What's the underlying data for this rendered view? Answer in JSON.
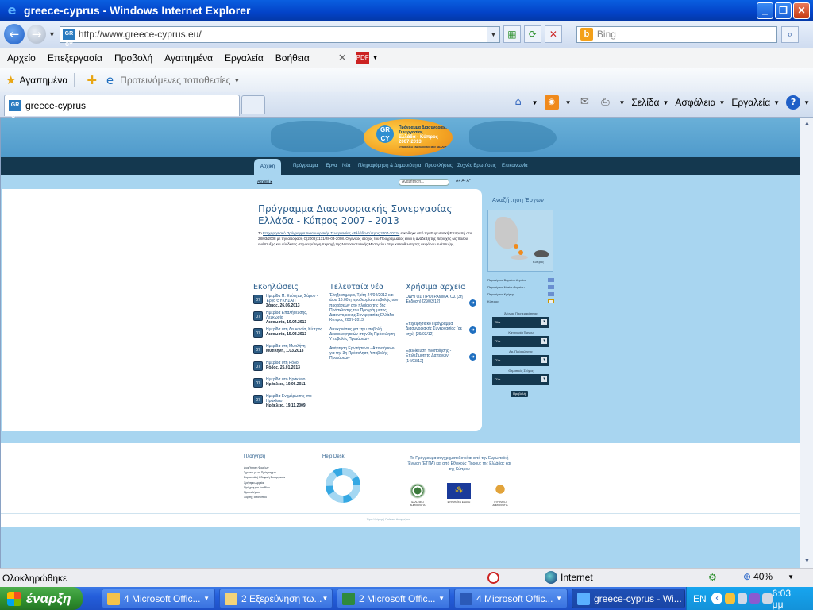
{
  "window": {
    "title": "greece-cyprus - Windows Internet Explorer"
  },
  "address": {
    "url": "http://www.greece-cyprus.eu/",
    "search_placeholder": "Bing",
    "favicon": "GR CY"
  },
  "menu": [
    "Αρχείο",
    "Επεξεργασία",
    "Προβολή",
    "Αγαπημένα",
    "Εργαλεία",
    "Βοήθεια"
  ],
  "favorites": {
    "label": "Αγαπημένα",
    "suggested": "Προτεινόμενες τοποθεσίες"
  },
  "tab": {
    "title": "greece-cyprus"
  },
  "commands": {
    "page": "Σελίδα",
    "safety": "Ασφάλεια",
    "tools": "Εργαλεία"
  },
  "site": {
    "logo": {
      "mark": "GR CY",
      "line1": "Πρόγραμμα Διασυνοριακής Συνεργασίας",
      "line2": "Ελλάδα - Κύπρος 2007-2013",
      "line3": "ΕΥΡΩΠΑΪΚΗ ΕΝΩΣΗ ΚΟΙΝΟ ΜΑΣ ΜΕΛΛΟΝ"
    },
    "nav": [
      "Αρχική",
      "Πρόγραμμα",
      "Έργα",
      "Νέα",
      "Πληροφόρηση & Δημοσιότητα",
      "Προσκλήσεις",
      "Συχνές Ερωτήσεις",
      "Επικοινωνία"
    ],
    "breadcrumb": "Αρχική ▸",
    "search_placeholder": "Αναζήτηση...",
    "font_sizes": "A+ A- A*",
    "title": "Πρόγραμμα Διασυνοριακής Συνεργασίας Ελλάδα - Κύπρος 2007 - 2013",
    "intro_link": "Επιχειρησιακό Πρόγραμμα Διασυνοριακής Συνεργασίας «Ελλάδα-Κύπρος 2007-2013»",
    "intro_pre": "Το",
    "intro_rest": "εγκρίθηκε από την Ευρωπαϊκή Επιτροπή στις 28/03/2008 με την απόφαση C(2008)1131/28-03-2008. Ο γενικός στόχος του Προγράμματος είναι η ανάδειξη της περιοχής ως πόλου ανάπτυξης και σύνδεσης στην ευρύτερη περιοχή της Νοτιοανατολικής Μεσογείου στην κατεύθυνση της αειφόρου ανάπτυξης.",
    "events_title": "Εκδηλώσεις",
    "events": [
      {
        "day": "07",
        "text": "Ημερίδα Π. Ενότητας Σάμου - Έργο ΘΥΚΗΣΑΠ",
        "date": "Σάμος, 26.06.2013"
      },
      {
        "day": "07",
        "text": "Ημερίδα Επαλήθευσης, Λευκωσία",
        "date": "Λευκωσία, 19.04.2013"
      },
      {
        "day": "07",
        "text": "Ημερίδα στη Λευκωσία, Κύπρος",
        "date": "Λευκωσία, 15.03.2013"
      },
      {
        "day": "07",
        "text": "Ημερίδα στη Μυτιλήνη",
        "date": "Μυτιλήνη, 1.03.2013"
      },
      {
        "day": "07",
        "text": "Ημερίδα στη Ρόδο",
        "date": "Ρόδος, 25.01.2013"
      },
      {
        "day": "07",
        "text": "Ημερίδα στο Ηράκλειο",
        "date": "Ηράκλειο, 10.06.2011"
      },
      {
        "day": "07",
        "text": "Ημερίδα Ενημέρωσης στο Ηράκλειο",
        "date": "Ηράκλειο, 19.11.2009"
      }
    ],
    "news_title": "Τελευταία νέα",
    "news": [
      "Έληξε σήμερα, Τρίτη 24/04/2012 και ώρα 16:00 η προθεσμία υποβολής των προτάσεων στο πλαίσιο της 3ης Πρόσκλησης του Προγράμματος Διασυνοριακής Συνεργασίας Ελλάδα-Κύπρος 2007-2013",
      "Διευκρινίσεις για την υποβολή Δικαιολογητικών στην 3η Πρόσκληση Υποβολής Προτάσεων",
      "Ανάρτηση Ερωτήσεων - Απαντήσεων για την 3η Πρόσκληση Υποβολής Προτάσεων"
    ],
    "files_title": "Χρήσιμα αρχεία",
    "files": [
      "ΟΔΗΓΟΣ ΠΡΟΓΡΑΜΜΑΤΟΣ (3η Έκδοση) [29/03/12]",
      "Επιχειρησιακό Πρόγραμμα Διασυνοριακής Συνεργασίας (σε ισχύ) [29/03/12]",
      "Εξειδίκευση Υλοποίησης - Επιλεξιμότητα Δαπανών [14/03/12]"
    ],
    "side": {
      "title": "Αναζήτηση Έργων",
      "map_label": "Κύπρος",
      "regions": [
        "Περιφέρεια Βορείου Αιγαίου",
        "Περιφέρεια Νοτίου Αιγαίου",
        "Περιφέρεια Κρήτης",
        "Κύπρος"
      ],
      "filters": [
        {
          "label": "Άξονας Προτεραιότητας",
          "value": "Όλα"
        },
        {
          "label": "Κατηγορία Έργου",
          "value": "Όλα"
        },
        {
          "label": "Αρ. Πρόσκλησης",
          "value": "Όλα"
        },
        {
          "label": "Θεματικός Στόχος",
          "value": "Όλα"
        }
      ],
      "button": "Προβολή"
    },
    "footer": {
      "nav_title": "Πλοήγηση",
      "links": [
        "Αναζήτηση Φορέων",
        "Σχετικά με το Πρόγραμμα",
        "Ευρωπαϊκή Εδαφική Συνεργασία",
        "Χρήσιμα Αρχεία",
        "Πρόγραμμα Δια Βίου",
        "Προσκλήσεις",
        "Χάρτης Ιστότοπου"
      ],
      "help_title": "Help Desk",
      "funding": "Το Πρόγραμμα συγχρηματοδοτείται από την Ευρωπαϊκή Ένωση (ΕΤΠΑ) και από Εθνικούς Πόρους της Ελλάδας και της Κύπρου",
      "logos": [
        "ΕΛΛΗΝΙΚΗ ΔΗΜΟΚΡΑΤΙΑ",
        "ΕΥΡΩΠΑΪΚΗ ΕΝΩΣΗ",
        "ΚΥΠΡΙΑΚΗ ΔΗΜΟΚΡΑΤΙΑ"
      ],
      "bottom": "Όροι Χρήσης | Πολιτική Απορρήτου"
    }
  },
  "status": {
    "text": "Ολοκληρώθηκε",
    "zone": "Internet",
    "zoom": "40%"
  },
  "taskbar": {
    "start": "έναρξη",
    "tasks": [
      "4 Microsoft Offic...",
      "2 Εξερεύνηση τω...",
      "2 Microsoft Offic...",
      "4 Microsoft Offic...",
      "greece-cyprus - Wi..."
    ],
    "lang": "EN",
    "clock": "6:03 μμ"
  },
  "colors": {
    "accent": "#0a5fe0",
    "site_bg": "#a8d5f0",
    "nav_bg": "#14384f",
    "title": "#2a5d8c"
  }
}
